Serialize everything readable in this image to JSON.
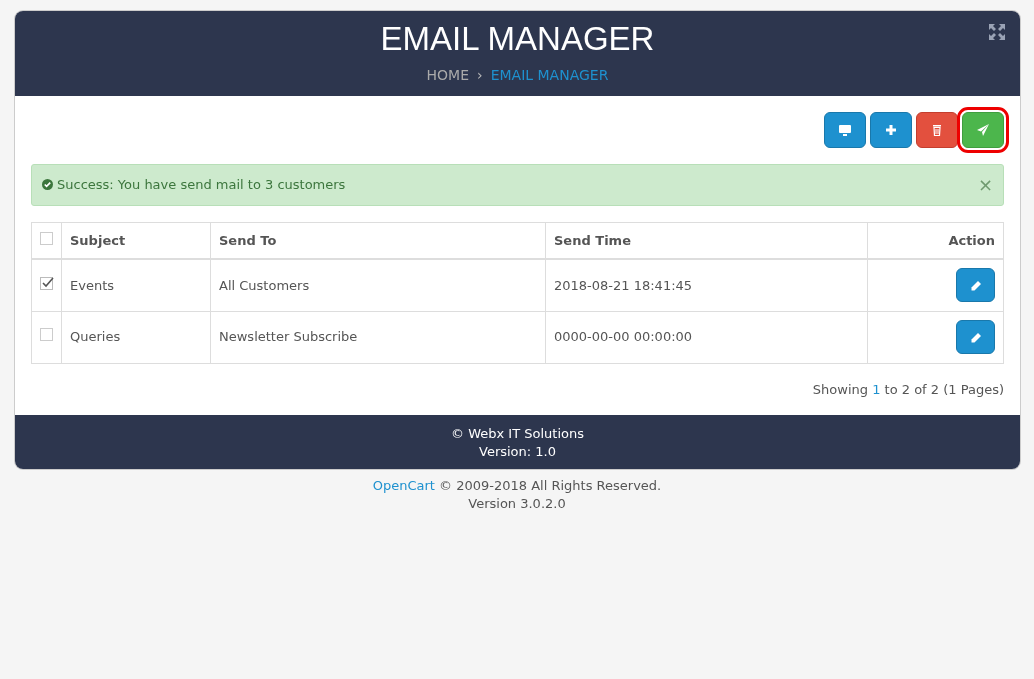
{
  "header": {
    "title": "EMAIL MANAGER",
    "breadcrumbs": [
      {
        "label": "HOME",
        "selected": false
      },
      {
        "separator": "›",
        "label": "EMAIL MANAGER",
        "selected": true
      }
    ]
  },
  "toolbar": [
    {
      "kind": "monitor",
      "highlighted": false
    },
    {
      "kind": "plus",
      "highlighted": false
    },
    {
      "kind": "trash",
      "highlighted": false
    },
    {
      "kind": "send",
      "highlighted": true
    }
  ],
  "alert": {
    "text": "Success: You have send mail to 3 customers",
    "close": "×"
  },
  "table": {
    "columns": [
      "Subject",
      "Send To",
      "Send Time",
      "Action"
    ],
    "select_all_checked": false,
    "rows": [
      {
        "checked": true,
        "cells": [
          "Events",
          "All Customers",
          "2018-08-21 18:41:45"
        ]
      },
      {
        "checked": false,
        "cells": [
          "Queries",
          "Newsletter Subscribe",
          "0000-00-00 00:00:00"
        ]
      }
    ]
  },
  "pagination": {
    "prefix": "Showing",
    "page": "1",
    "suffix": "to 2 of 2 (1 Pages)"
  },
  "panel_footer": [
    "© Webx IT Solutions",
    "Version: 1.0"
  ],
  "page_footer": {
    "link": "OpenCart",
    "text": "© 2009-2018 All Rights Reserved.",
    "version": "Version 3.0.2.0"
  }
}
